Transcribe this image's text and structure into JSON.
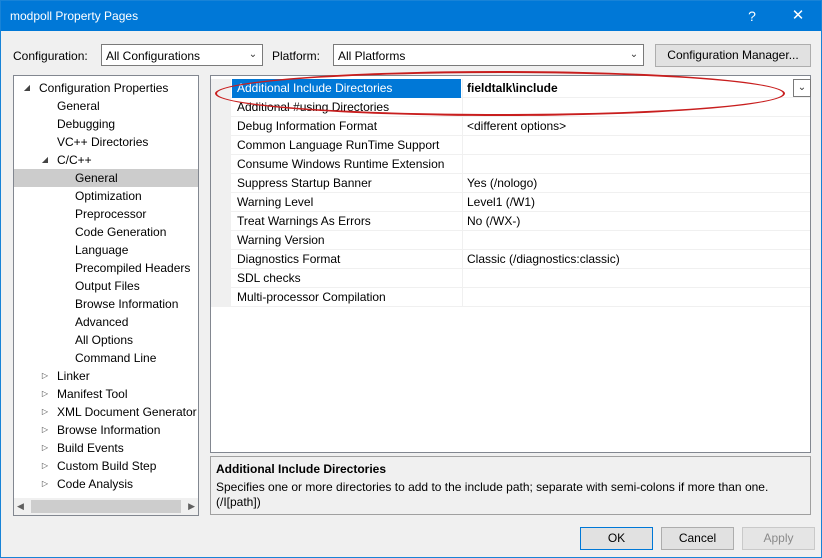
{
  "window": {
    "title": "modpoll Property Pages",
    "help_label": "?",
    "close_label": "✕"
  },
  "toolbar": {
    "configuration_label": "Configuration:",
    "configuration_value": "All Configurations",
    "platform_label": "Platform:",
    "platform_value": "All Platforms",
    "config_manager_label": "Configuration Manager..."
  },
  "tree": {
    "items": [
      {
        "label": "Configuration Properties",
        "expander": "◢",
        "depth": 0
      },
      {
        "label": "General",
        "expander": "",
        "depth": 1
      },
      {
        "label": "Debugging",
        "expander": "",
        "depth": 1
      },
      {
        "label": "VC++ Directories",
        "expander": "",
        "depth": 1
      },
      {
        "label": "C/C++",
        "expander": "◢",
        "depth": 1
      },
      {
        "label": "General",
        "expander": "",
        "depth": 2,
        "selected": true
      },
      {
        "label": "Optimization",
        "expander": "",
        "depth": 2
      },
      {
        "label": "Preprocessor",
        "expander": "",
        "depth": 2
      },
      {
        "label": "Code Generation",
        "expander": "",
        "depth": 2
      },
      {
        "label": "Language",
        "expander": "",
        "depth": 2
      },
      {
        "label": "Precompiled Headers",
        "expander": "",
        "depth": 2
      },
      {
        "label": "Output Files",
        "expander": "",
        "depth": 2
      },
      {
        "label": "Browse Information",
        "expander": "",
        "depth": 2
      },
      {
        "label": "Advanced",
        "expander": "",
        "depth": 2
      },
      {
        "label": "All Options",
        "expander": "",
        "depth": 2
      },
      {
        "label": "Command Line",
        "expander": "",
        "depth": 2
      },
      {
        "label": "Linker",
        "expander": "▷",
        "depth": 1
      },
      {
        "label": "Manifest Tool",
        "expander": "▷",
        "depth": 1
      },
      {
        "label": "XML Document Generator",
        "expander": "▷",
        "depth": 1
      },
      {
        "label": "Browse Information",
        "expander": "▷",
        "depth": 1
      },
      {
        "label": "Build Events",
        "expander": "▷",
        "depth": 1
      },
      {
        "label": "Custom Build Step",
        "expander": "▷",
        "depth": 1
      },
      {
        "label": "Code Analysis",
        "expander": "▷",
        "depth": 1
      }
    ]
  },
  "grid": {
    "rows": [
      {
        "name": "Additional Include Directories",
        "value": "fieldtalk\\include",
        "selected": true
      },
      {
        "name": "Additional #using Directories",
        "value": ""
      },
      {
        "name": "Debug Information Format",
        "value": "<different options>"
      },
      {
        "name": "Common Language RunTime Support",
        "value": ""
      },
      {
        "name": "Consume Windows Runtime Extension",
        "value": ""
      },
      {
        "name": "Suppress Startup Banner",
        "value": "Yes (/nologo)"
      },
      {
        "name": "Warning Level",
        "value": "Level1 (/W1)"
      },
      {
        "name": "Treat Warnings As Errors",
        "value": "No (/WX-)"
      },
      {
        "name": "Warning Version",
        "value": ""
      },
      {
        "name": "Diagnostics Format",
        "value": "Classic (/diagnostics:classic)"
      },
      {
        "name": "SDL checks",
        "value": ""
      },
      {
        "name": "Multi-processor Compilation",
        "value": ""
      }
    ]
  },
  "description": {
    "title": "Additional Include Directories",
    "body": "Specifies one or more directories to add to the include path; separate with semi-colons if more than one. (/I[path])"
  },
  "buttons": {
    "ok": "OK",
    "cancel": "Cancel",
    "apply": "Apply"
  },
  "colors": {
    "accent": "#0078d7",
    "annotation": "#c81e1e"
  }
}
